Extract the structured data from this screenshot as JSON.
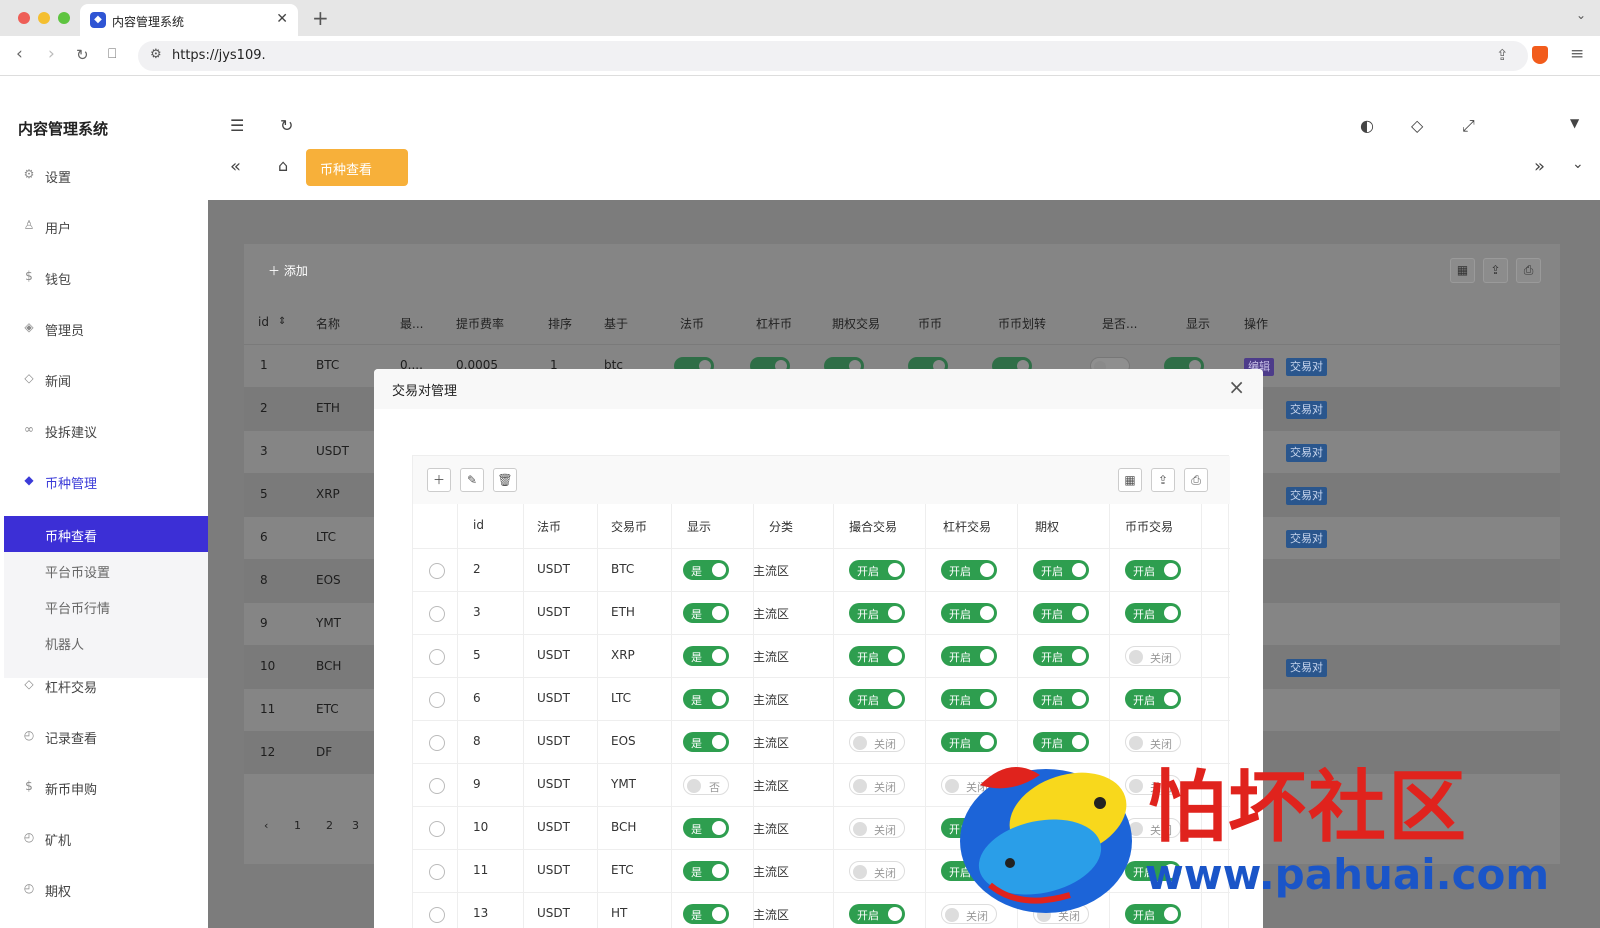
{
  "browser": {
    "tab_title": "内容管理系统",
    "url": "https://jys109."
  },
  "sidebar": {
    "title": "内容管理系统",
    "items": [
      {
        "label": "设置",
        "icon": "gear-icon"
      },
      {
        "label": "用户",
        "icon": "user-icon"
      },
      {
        "label": "钱包",
        "icon": "dollar-icon"
      },
      {
        "label": "管理员",
        "icon": "shield-icon"
      },
      {
        "label": "新闻",
        "icon": "tag-icon"
      },
      {
        "label": "投拆建议",
        "icon": "link-icon"
      },
      {
        "label": "币种管理",
        "icon": "diamond-icon"
      }
    ],
    "subitems": [
      {
        "label": "币种查看"
      },
      {
        "label": "平台币设置"
      },
      {
        "label": "平台币行情"
      },
      {
        "label": "机器人"
      }
    ],
    "items_after": [
      {
        "label": "杠杆交易",
        "icon": "diamond-icon"
      },
      {
        "label": "记录查看",
        "icon": "clock-icon"
      },
      {
        "label": "新币申购",
        "icon": "dollar-icon"
      },
      {
        "label": "矿机",
        "icon": "clock-icon"
      },
      {
        "label": "期权",
        "icon": "clock-icon"
      }
    ]
  },
  "header": {
    "active_tag": "币种查看"
  },
  "bg_table": {
    "add_label": "添加",
    "columns": [
      "id",
      "名称",
      "最...",
      "提币费率",
      "排序",
      "基于",
      "法币",
      "杠杆币",
      "期权交易",
      "币币",
      "币币划转",
      "是否...",
      "显示",
      "操作"
    ],
    "rows": [
      {
        "id": "1",
        "name": "BTC",
        "min": "0....",
        "fee": "0.0005",
        "sort": "1",
        "base": "btc"
      },
      {
        "id": "2",
        "name": "ETH"
      },
      {
        "id": "3",
        "name": "USDT"
      },
      {
        "id": "5",
        "name": "XRP"
      },
      {
        "id": "6",
        "name": "LTC"
      },
      {
        "id": "8",
        "name": "EOS"
      },
      {
        "id": "9",
        "name": "YMT"
      },
      {
        "id": "10",
        "name": "BCH"
      },
      {
        "id": "11",
        "name": "ETC"
      },
      {
        "id": "12",
        "name": "DF"
      }
    ],
    "sw_on": "是",
    "sw_off": "否",
    "edit_label": "编辑",
    "pair_label": "交易对",
    "pager": [
      "1",
      "2",
      "3"
    ]
  },
  "modal": {
    "title": "交易对管理",
    "columns": [
      "id",
      "法币",
      "交易币",
      "显示",
      "分类",
      "撮合交易",
      "杠杆交易",
      "期权",
      "币币交易"
    ],
    "on_yes": "是",
    "off_no": "否",
    "on_open": "开启",
    "off_close": "关闭",
    "rows": [
      {
        "id": "2",
        "fiat": "USDT",
        "coin": "BTC",
        "show": true,
        "cat": "主流区",
        "match": true,
        "lever": true,
        "option": true,
        "spot": true
      },
      {
        "id": "3",
        "fiat": "USDT",
        "coin": "ETH",
        "show": true,
        "cat": "主流区",
        "match": true,
        "lever": true,
        "option": true,
        "spot": true
      },
      {
        "id": "5",
        "fiat": "USDT",
        "coin": "XRP",
        "show": true,
        "cat": "主流区",
        "match": true,
        "lever": true,
        "option": true,
        "spot": false
      },
      {
        "id": "6",
        "fiat": "USDT",
        "coin": "LTC",
        "show": true,
        "cat": "主流区",
        "match": true,
        "lever": true,
        "option": true,
        "spot": true
      },
      {
        "id": "8",
        "fiat": "USDT",
        "coin": "EOS",
        "show": true,
        "cat": "主流区",
        "match": false,
        "lever": true,
        "option": true,
        "spot": false
      },
      {
        "id": "9",
        "fiat": "USDT",
        "coin": "YMT",
        "show": false,
        "cat": "主流区",
        "match": false,
        "lever": false,
        "option": false,
        "spot": false
      },
      {
        "id": "10",
        "fiat": "USDT",
        "coin": "BCH",
        "show": true,
        "cat": "主流区",
        "match": false,
        "lever": true,
        "option": true,
        "spot": false
      },
      {
        "id": "11",
        "fiat": "USDT",
        "coin": "ETC",
        "show": true,
        "cat": "主流区",
        "match": false,
        "lever": true,
        "option": true,
        "spot": true
      },
      {
        "id": "13",
        "fiat": "USDT",
        "coin": "HT",
        "show": true,
        "cat": "主流区",
        "match": true,
        "lever": false,
        "option": false,
        "spot": true
      }
    ]
  },
  "watermark": {
    "text": "怕坏社区",
    "url": "www.pahuai.com"
  },
  "colors": {
    "accent": "#3c2fd6",
    "tag": "#f7b03a",
    "switch_on": "#2e9e4f",
    "watermark_red": "#e0231d",
    "watermark_blue": "#1a55c8"
  }
}
